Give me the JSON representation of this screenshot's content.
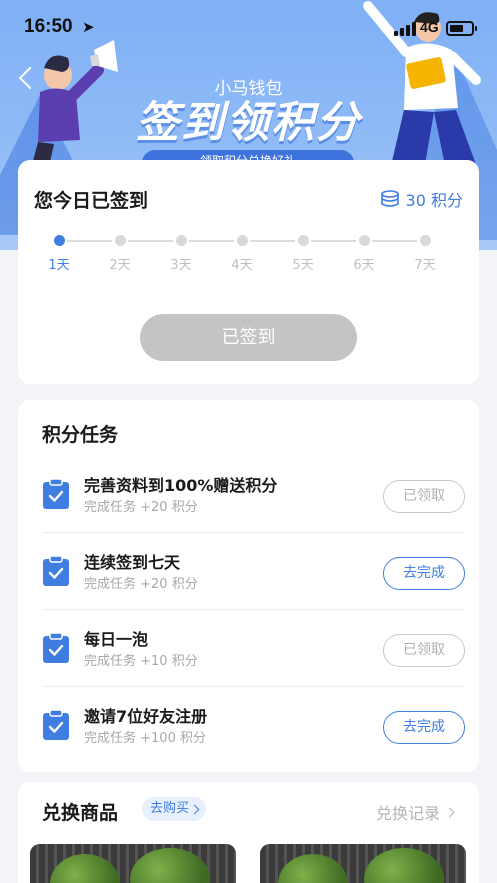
{
  "status_bar": {
    "time": "16:50",
    "network": "4G"
  },
  "header": {
    "app_name": "小马钱包",
    "title": "签到领积分",
    "subtitle": "领取积分兑换好礼"
  },
  "sign_in": {
    "title": "您今日已签到",
    "points": "30 积分",
    "days": [
      "1天",
      "2天",
      "3天",
      "4天",
      "5天",
      "6天",
      "7天"
    ],
    "current_day": 1,
    "button_label": "已签到"
  },
  "tasks": {
    "heading": "积分任务",
    "items": [
      {
        "name": "完善资料到100%赠送积分",
        "reward": "完成任务 +20 积分",
        "button": "已领取",
        "state": "done"
      },
      {
        "name": "连续签到七天",
        "reward": "完成任务 +20 积分",
        "button": "去完成",
        "state": "todo"
      },
      {
        "name": "每日一泡",
        "reward": "完成任务 +10 积分",
        "button": "已领取",
        "state": "done"
      },
      {
        "name": "邀请7位好友注册",
        "reward": "完成任务 +100 积分",
        "button": "去完成",
        "state": "todo"
      }
    ]
  },
  "shop": {
    "title": "兑换商品",
    "badge": "去购买",
    "records": "兑换记录"
  },
  "colors": {
    "accent": "#3f7de0",
    "hero": "#8fbaf6",
    "disabled": "#c4c4c4"
  }
}
